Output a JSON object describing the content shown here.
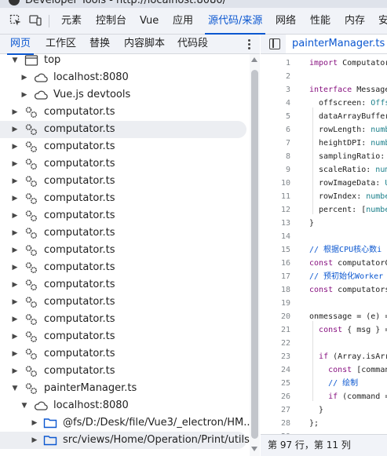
{
  "window": {
    "title": "Developer Tools - http://localhost:8080/"
  },
  "main_tabs": [
    "元素",
    "控制台",
    "Vue",
    "应用",
    "源代码/来源",
    "网络",
    "性能",
    "内存",
    "安"
  ],
  "active_main_tab": "源代码/来源",
  "sources_subtabs": [
    "网页",
    "工作区",
    "替换",
    "内容脚本",
    "代码段"
  ],
  "active_subtab": "网页",
  "tree": {
    "top": "top",
    "localhost": "localhost:8080",
    "vue_devtools": "Vue.js devtools",
    "computator_label": "computator.ts",
    "painter_manager": "painterManager.ts",
    "painter_host": "localhost:8080",
    "fs_folder": "@fs/D:/Desk/file/Vue3/_electron/HM...",
    "src_folder": "src/views/Home/Operation/Print/utils"
  },
  "editor": {
    "open_file": "painterManager.ts",
    "lines": [
      {
        "n": "1",
        "parts": [
          [
            "kw",
            "import"
          ],
          [
            "",
            " Computator"
          ]
        ]
      },
      {
        "n": "2",
        "parts": []
      },
      {
        "n": "3",
        "parts": [
          [
            "kw",
            "interface"
          ],
          [
            "",
            " Message"
          ]
        ]
      },
      {
        "n": "4",
        "parts": [
          [
            "",
            "  offscreen: "
          ],
          [
            "typ",
            "Offs"
          ]
        ]
      },
      {
        "n": "5",
        "parts": [
          [
            "",
            "  dataArrayBuffer"
          ]
        ]
      },
      {
        "n": "6",
        "parts": [
          [
            "",
            "  rowLength: "
          ],
          [
            "typ",
            "numb"
          ]
        ]
      },
      {
        "n": "7",
        "parts": [
          [
            "",
            "  heightDPI: "
          ],
          [
            "typ",
            "numb"
          ]
        ]
      },
      {
        "n": "8",
        "parts": [
          [
            "",
            "  samplingRatio: "
          ]
        ]
      },
      {
        "n": "9",
        "parts": [
          [
            "",
            "  scaleRatio: "
          ],
          [
            "typ",
            "num"
          ]
        ]
      },
      {
        "n": "10",
        "parts": [
          [
            "",
            "  rowImageData: "
          ],
          [
            "typ",
            "U"
          ]
        ]
      },
      {
        "n": "11",
        "parts": [
          [
            "",
            "  rowIndex: "
          ],
          [
            "typ",
            "numbe"
          ]
        ]
      },
      {
        "n": "12",
        "parts": [
          [
            "",
            "  percent: ["
          ],
          [
            "typ",
            "numbe"
          ]
        ]
      },
      {
        "n": "13",
        "parts": [
          [
            "",
            "}"
          ]
        ]
      },
      {
        "n": "14",
        "parts": []
      },
      {
        "n": "15",
        "parts": [
          [
            "cmt",
            "// 根据CPU核心数i"
          ]
        ]
      },
      {
        "n": "16",
        "parts": [
          [
            "kw",
            "const"
          ],
          [
            "",
            " computatorC"
          ]
        ]
      },
      {
        "n": "17",
        "parts": [
          [
            "cmt",
            "// 预初始化Worker"
          ]
        ]
      },
      {
        "n": "18",
        "parts": [
          [
            "kw",
            "const"
          ],
          [
            "",
            " computators"
          ]
        ]
      },
      {
        "n": "19",
        "parts": []
      },
      {
        "n": "20",
        "parts": [
          [
            "",
            "onmessage = (e) ="
          ]
        ]
      },
      {
        "n": "21",
        "parts": [
          [
            "",
            "  "
          ],
          [
            "kw",
            "const"
          ],
          [
            "",
            " { msg } ="
          ]
        ]
      },
      {
        "n": "22",
        "parts": []
      },
      {
        "n": "23",
        "parts": [
          [
            "",
            "  "
          ],
          [
            "kw",
            "if"
          ],
          [
            "",
            " (Array.isArr"
          ]
        ]
      },
      {
        "n": "24",
        "parts": [
          [
            "",
            "    "
          ],
          [
            "kw",
            "const"
          ],
          [
            "",
            " [comman"
          ]
        ]
      },
      {
        "n": "25",
        "parts": [
          [
            "cmt",
            "    // 绘制"
          ]
        ]
      },
      {
        "n": "26",
        "parts": [
          [
            "",
            "    "
          ],
          [
            "kw",
            "if"
          ],
          [
            "",
            " (command ="
          ]
        ]
      },
      {
        "n": "27",
        "parts": [
          [
            "",
            "  }"
          ]
        ]
      },
      {
        "n": "28",
        "parts": [
          [
            "",
            "};"
          ]
        ]
      },
      {
        "n": "29",
        "parts": []
      }
    ]
  },
  "status": {
    "cursor": "第 97 行，第 11 列"
  },
  "colors": {
    "accent": "#0b57d0",
    "keyword": "#881280",
    "type": "#1a7f8a"
  },
  "icons": {
    "more": "more-vert-icon",
    "toggle_navigator": "sidebar-toggle-icon",
    "frame": "window-frame-icon",
    "cloud": "cloud-icon",
    "file_gear": "file-gear-icon",
    "folder": "folder-icon"
  }
}
